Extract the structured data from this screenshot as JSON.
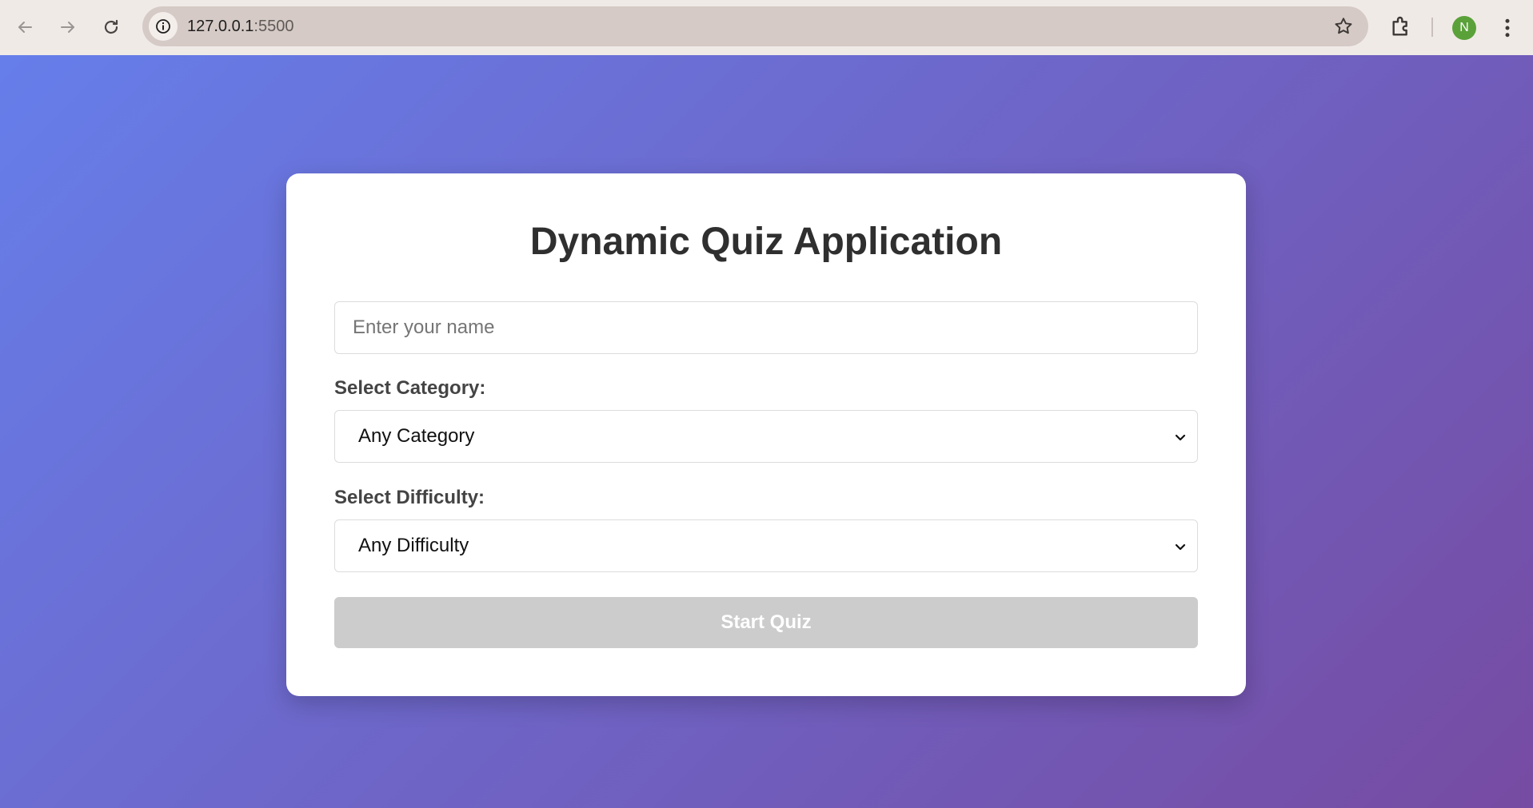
{
  "browser": {
    "url_host": "127.0.0.1",
    "url_port": ":5500",
    "profile_initial": "N"
  },
  "icons": {
    "back": "arrow-left-icon",
    "forward": "arrow-right-icon",
    "reload": "reload-icon",
    "site_info": "info-icon",
    "bookmark": "star-icon",
    "extensions": "puzzle-icon",
    "menu": "kebab-menu-icon",
    "dropdown": "chevron-down-icon"
  },
  "colors": {
    "gradient_start": "#667eea",
    "gradient_end": "#764ba2",
    "button_disabled": "#cccccc",
    "avatar": "#5aa13a"
  },
  "quiz": {
    "title": "Dynamic Quiz Application",
    "name_placeholder": "Enter your name",
    "name_value": "",
    "category_label": "Select Category:",
    "category_selected": "Any Category",
    "difficulty_label": "Select Difficulty:",
    "difficulty_selected": "Any Difficulty",
    "start_button": "Start Quiz"
  }
}
